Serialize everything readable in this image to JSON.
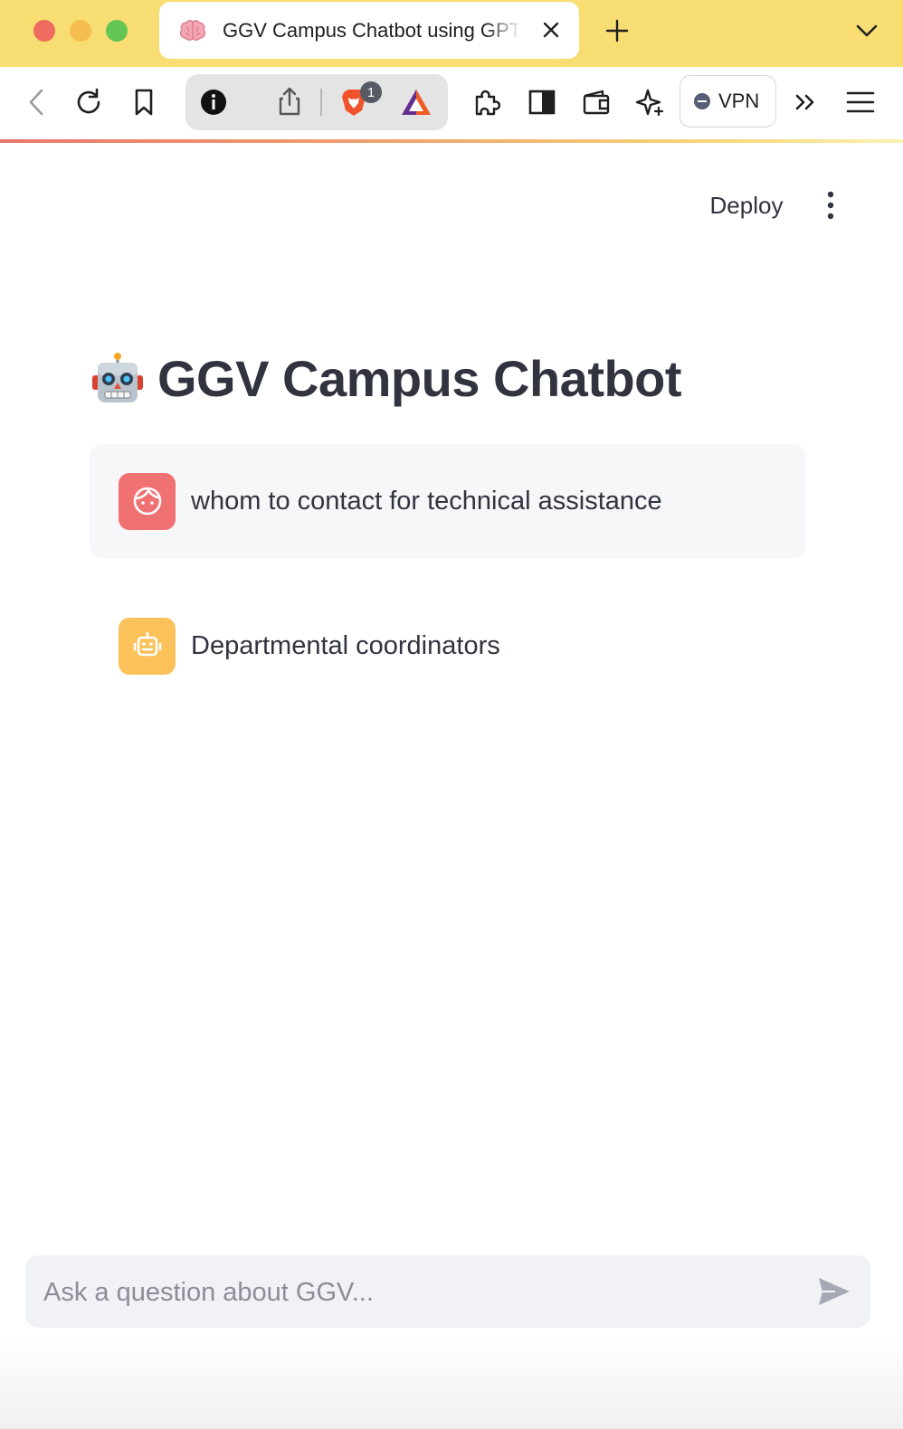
{
  "browser": {
    "tab": {
      "title": "GGV Campus Chatbot using GPT",
      "favicon": "brain-icon"
    },
    "toolbar": {
      "notification_count": "1",
      "vpn_label": "VPN"
    },
    "colors": {
      "tabbar": "#f8de72",
      "accent_gradient": [
        "#e9776c",
        "#f6d978"
      ]
    }
  },
  "app": {
    "header": {
      "deploy_label": "Deploy",
      "menu_icon": "kebab-menu-icon"
    },
    "title": "GGV Campus Chatbot",
    "title_icon": "robot-face-emoji",
    "messages": [
      {
        "role": "user",
        "avatar": "user-face-icon",
        "text": "whom to contact for technical assistance"
      },
      {
        "role": "assistant",
        "avatar": "robot-icon",
        "text": "Departmental coordinators"
      }
    ],
    "chat_input": {
      "placeholder": "Ask a question about GGV...",
      "value": ""
    },
    "colors": {
      "text": "#31333f",
      "user_avatar": "#f07171",
      "bot_avatar": "#fbc15a",
      "input_bg": "#f0f2f6"
    }
  }
}
